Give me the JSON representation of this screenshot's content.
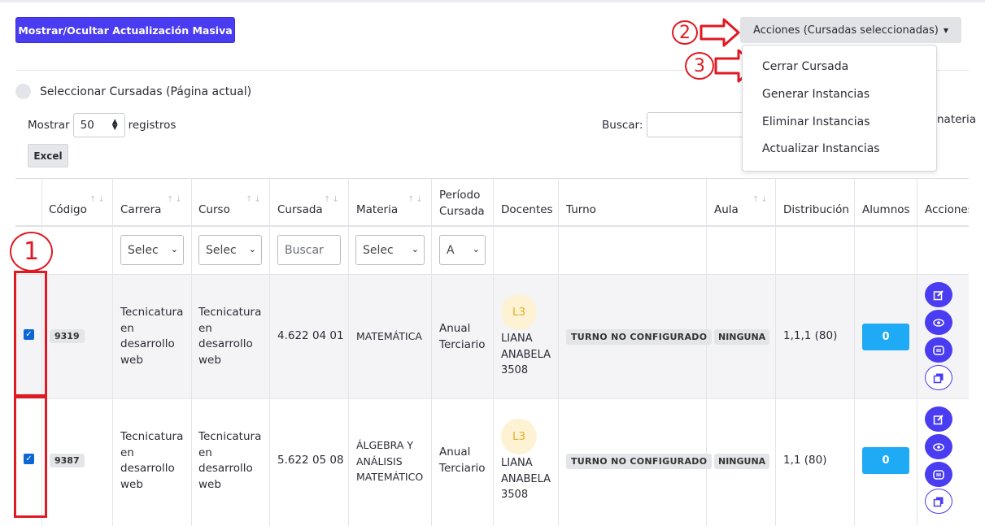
{
  "toolbar": {
    "toggle_label": "Mostrar/Ocultar Actualización Masiva",
    "actions_label": "Acciones (Cursadas seleccionadas)"
  },
  "dropdown": {
    "items": [
      "Cerrar Cursada",
      "Generar Instancias",
      "Eliminar Instancias",
      "Actualizar Instancias"
    ]
  },
  "select_all_label": "Seleccionar Cursadas (Página actual)",
  "length": {
    "prefix": "Mostrar",
    "value": "50",
    "suffix": "registros"
  },
  "excel_label": "Excel",
  "search_label": "Buscar:",
  "hidden_fragment": "nateria",
  "columns": [
    "Código",
    "Carrera",
    "Curso",
    "Cursada",
    "Materia",
    "Período Cursada",
    "Docentes",
    "Turno",
    "Aula",
    "Distribución",
    "Alumnos",
    "Acciones"
  ],
  "filters": {
    "carrera": "Selec",
    "curso": "Selec",
    "cursada_placeholder": "Buscar",
    "materia": "Selec",
    "periodo": "A"
  },
  "rows": [
    {
      "checked": true,
      "codigo": "9319",
      "carrera": [
        "Tecnicatura",
        "en",
        "desarrollo",
        "web"
      ],
      "curso": [
        "Tecnicatura",
        "en",
        "desarrollo",
        "web"
      ],
      "cursada": "4.622 04 01",
      "materia": [
        "MATEMÁTICA"
      ],
      "periodo": [
        "Anual",
        "Terciario"
      ],
      "docente_initials": "L3",
      "docente": [
        "LIANA",
        "ANABELA",
        "3508"
      ],
      "turno": "TURNO NO CONFIGURADO",
      "aula": "NINGUNA",
      "distribucion": "1,1,1 (80)",
      "alumnos": "0"
    },
    {
      "checked": true,
      "codigo": "9387",
      "carrera": [
        "Tecnicatura",
        "en",
        "desarrollo",
        "web"
      ],
      "curso": [
        "Tecnicatura",
        "en",
        "desarrollo",
        "web"
      ],
      "cursada": "5.622 05 08",
      "materia": [
        "ÁLGEBRA Y",
        "ANÁLISIS",
        "MATEMÁTICO"
      ],
      "periodo": [
        "Anual",
        "Terciario"
      ],
      "docente_initials": "L3",
      "docente": [
        "LIANA",
        "ANABELA",
        "3508"
      ],
      "turno": "TURNO NO CONFIGURADO",
      "aula": "NINGUNA",
      "distribucion": "1,1 (80)",
      "alumnos": "0"
    }
  ],
  "annotations": {
    "step1": "1",
    "step2": "2",
    "step3": "3"
  },
  "colors": {
    "primary": "#4a3cf0",
    "info": "#1eaaf4",
    "annotation": "#e01a23",
    "checkbox": "#0c67d6",
    "avatar_text": "#e1b021"
  },
  "icons": [
    "edit-icon",
    "eye-icon",
    "barcode-icon",
    "copy-icon",
    "sort-arrows-icon",
    "chevron-down-icon",
    "checkmark-icon",
    "arrow-right-icon"
  ]
}
